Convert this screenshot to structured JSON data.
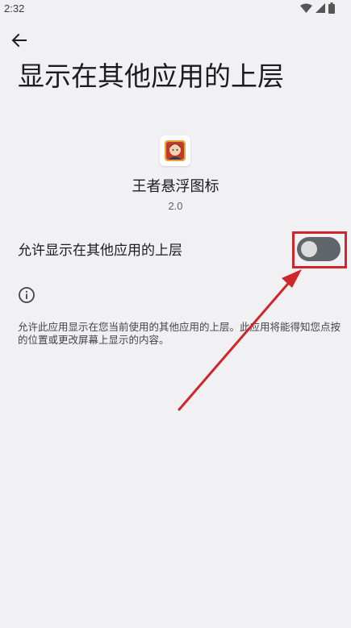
{
  "status_bar": {
    "time": "2:32",
    "icons": [
      "wifi-icon",
      "signal-icon",
      "battery-icon"
    ]
  },
  "header": {
    "back_icon": "arrow-left-icon",
    "title": "显示在其他应用的上层"
  },
  "app": {
    "icon": "app-icon",
    "name": "王者悬浮图标",
    "version": "2.0"
  },
  "setting": {
    "label": "允许显示在其他应用的上层",
    "enabled": false
  },
  "info": {
    "icon": "info-icon",
    "text": "允许此应用显示在您当前使用的其他应用的上层。此应用将能得知您点按的位置或更改屏幕上显示的内容。"
  },
  "colors": {
    "background": "#f1f1f4",
    "text": "#1c1b1f",
    "toggle_track": "#60656b",
    "toggle_thumb": "#dcdcdf",
    "annotation": "#d0252b"
  }
}
